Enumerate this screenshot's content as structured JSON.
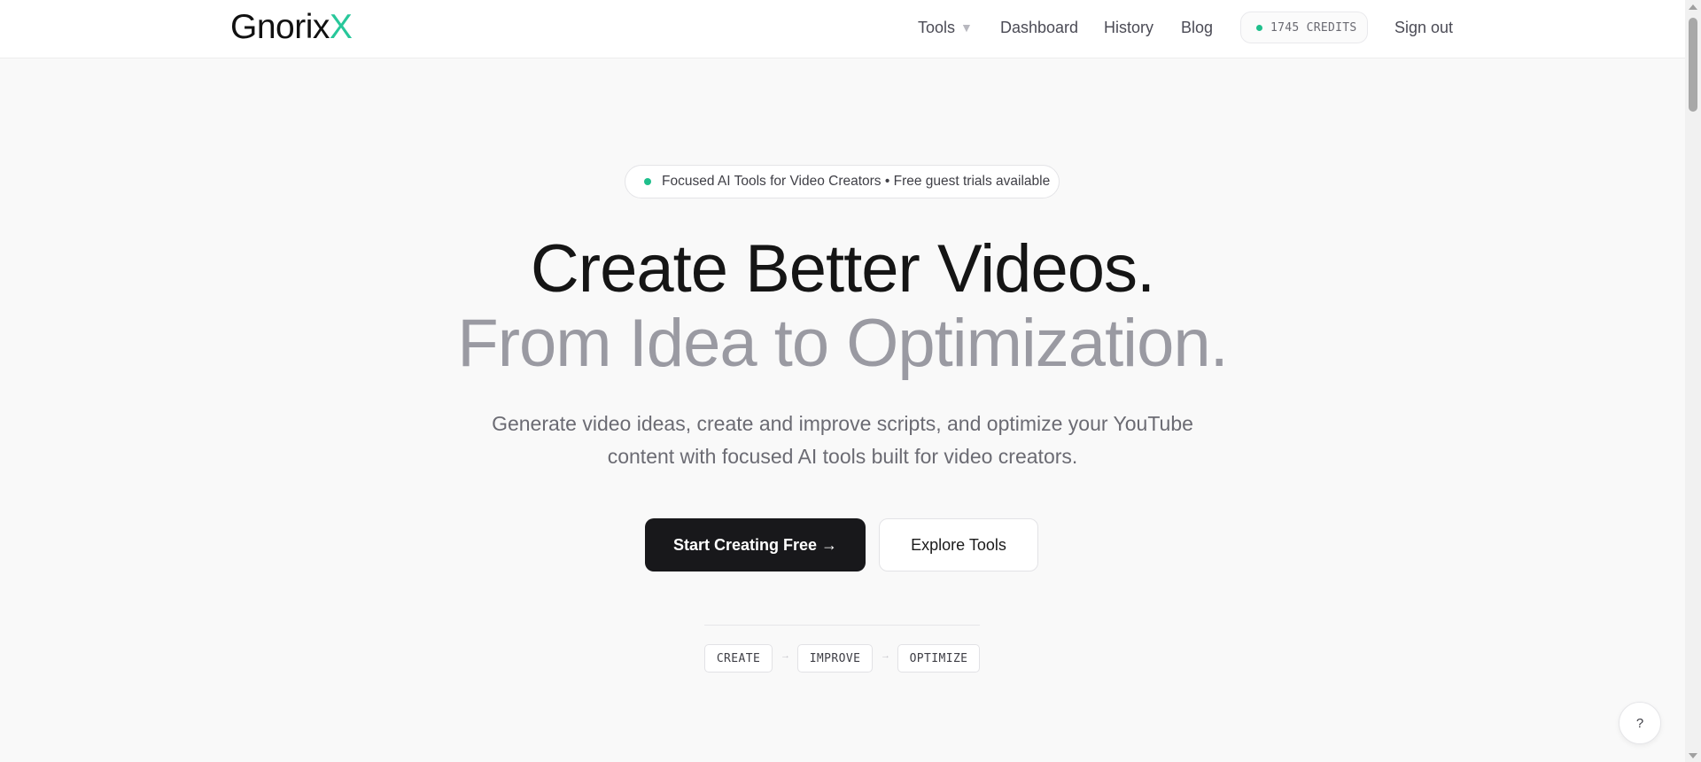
{
  "header": {
    "logo_main": "Gnorix",
    "logo_accent": "X",
    "nav": {
      "tools": "Tools",
      "dashboard": "Dashboard",
      "history": "History",
      "blog": "Blog",
      "sign_out": "Sign out"
    },
    "credits": "1745 CREDITS"
  },
  "hero": {
    "badge": "Focused AI Tools for Video Creators • Free guest trials available",
    "headline_line1": "Create Better Videos.",
    "headline_line2": "From Idea to Optimization.",
    "subtitle_line1": "Generate video ideas, create and improve scripts, and optimize your YouTube",
    "subtitle_line2": "content with focused AI tools built for video creators.",
    "primary_cta": "Start Creating Free →",
    "secondary_cta": "Explore Tools",
    "steps": [
      "CREATE",
      "IMPROVE",
      "OPTIMIZE"
    ],
    "step_arrow": "→"
  },
  "help_button": "?",
  "colors": {
    "accent": "#27c79a",
    "status_dot": "#1fbf8c",
    "primary_button": "#18181b",
    "headline_muted": "#9a9aa2"
  },
  "icons": {
    "tools_caret": "caret-down-icon",
    "help": "question-icon"
  }
}
